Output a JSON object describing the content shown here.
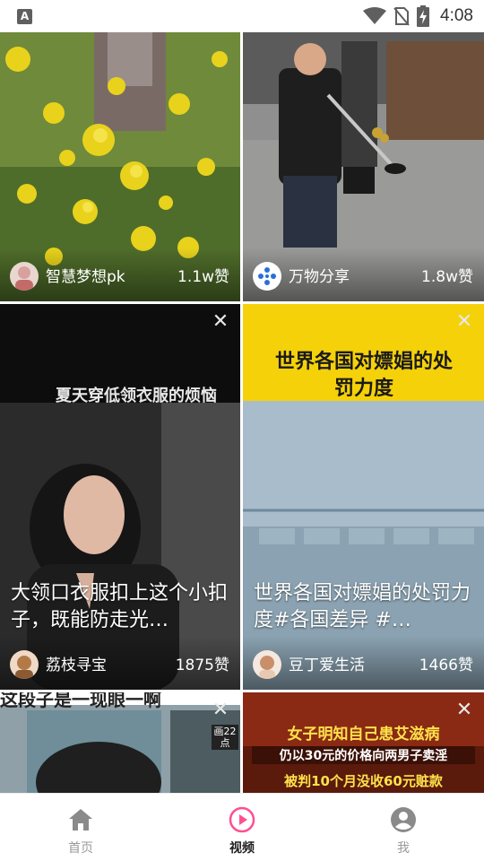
{
  "status_bar": {
    "left_icon": "A",
    "icons": [
      "wifi-icon",
      "no-sim-icon",
      "battery-charging-icon"
    ],
    "time": "4:08"
  },
  "feed": [
    {
      "author": "智慧梦想pk",
      "likes": "1.1w赞",
      "caption": "",
      "overlay_text": "",
      "has_close": false
    },
    {
      "author": "万物分享",
      "likes": "1.8w赞",
      "caption": "",
      "overlay_text": "",
      "has_close": false
    },
    {
      "author": "荔枝寻宝",
      "likes": "1875赞",
      "caption": "大领口衣服扣上这个小扣子，既能防走光…",
      "overlay_text": "夏天穿低领衣服的烦恼",
      "has_close": true
    },
    {
      "author": "豆丁爱生活",
      "likes": "1466赞",
      "caption": "世界各国对嫖娼的处罚力度#各国差异 #…",
      "overlay_text": "世界各国对嫖娼的处罚力度",
      "has_close": true
    },
    {
      "author": "",
      "likes": "",
      "caption": "",
      "overlay_text": "这段子是一现眼一啊",
      "badge": "画22点",
      "has_close": true
    },
    {
      "author": "",
      "likes": "",
      "caption": "",
      "overlay_text": "女子明知自己患艾滋病",
      "overlay_text_2": "仍以30元的价格向两男子卖淫",
      "overlay_text_3": "被判10个月没收60元赃款",
      "has_close": true
    }
  ],
  "close_symbol": "✕",
  "bottom_nav": [
    {
      "label": "首页",
      "icon": "home-icon",
      "active": false
    },
    {
      "label": "视频",
      "icon": "play-circle-icon",
      "active": true
    },
    {
      "label": "我",
      "icon": "user-icon",
      "active": false
    }
  ],
  "colors": {
    "accent": "#ff4f93",
    "inactive": "#8a8a8a",
    "banner_yellow": "#f5d10a"
  }
}
